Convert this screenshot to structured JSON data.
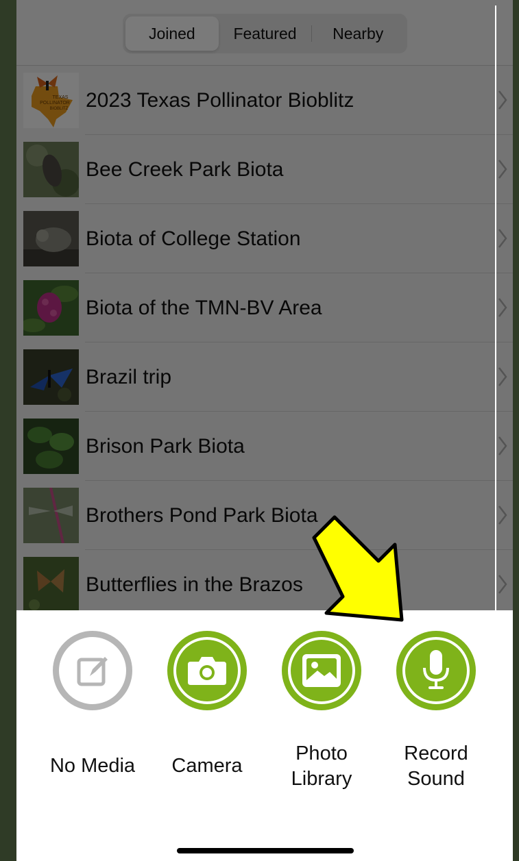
{
  "tabs": {
    "items": [
      "Joined",
      "Featured",
      "Nearby"
    ],
    "selected": "Joined"
  },
  "projects": [
    {
      "title": "2023 Texas Pollinator Bioblitz",
      "thumb_text": [
        "TEXAS",
        "POLLINATOR",
        "BIOBLITZ"
      ]
    },
    {
      "title": "Bee Creek Park Biota"
    },
    {
      "title": "Biota of College Station"
    },
    {
      "title": "Biota of the TMN-BV Area"
    },
    {
      "title": "Brazil trip"
    },
    {
      "title": "Brison Park Biota"
    },
    {
      "title": "Brothers Pond Park Biota"
    },
    {
      "title": "Butterflies in the Brazos"
    }
  ],
  "media_options": [
    {
      "label": "No Media",
      "icon": "edit-note-icon",
      "enabled": false
    },
    {
      "label": "Camera",
      "icon": "camera-icon",
      "enabled": true
    },
    {
      "label_lines": [
        "Photo",
        "Library"
      ],
      "icon": "photo-library-icon",
      "enabled": true
    },
    {
      "label_lines": [
        "Record",
        "Sound"
      ],
      "icon": "microphone-icon",
      "enabled": true
    }
  ],
  "colors": {
    "accent": "#7fb31a",
    "disabled": "#b6b6b6",
    "annotation_arrow": "#ffff00"
  },
  "annotation": {
    "icon": "yellow-arrow-icon",
    "points_to": "Record Sound"
  }
}
